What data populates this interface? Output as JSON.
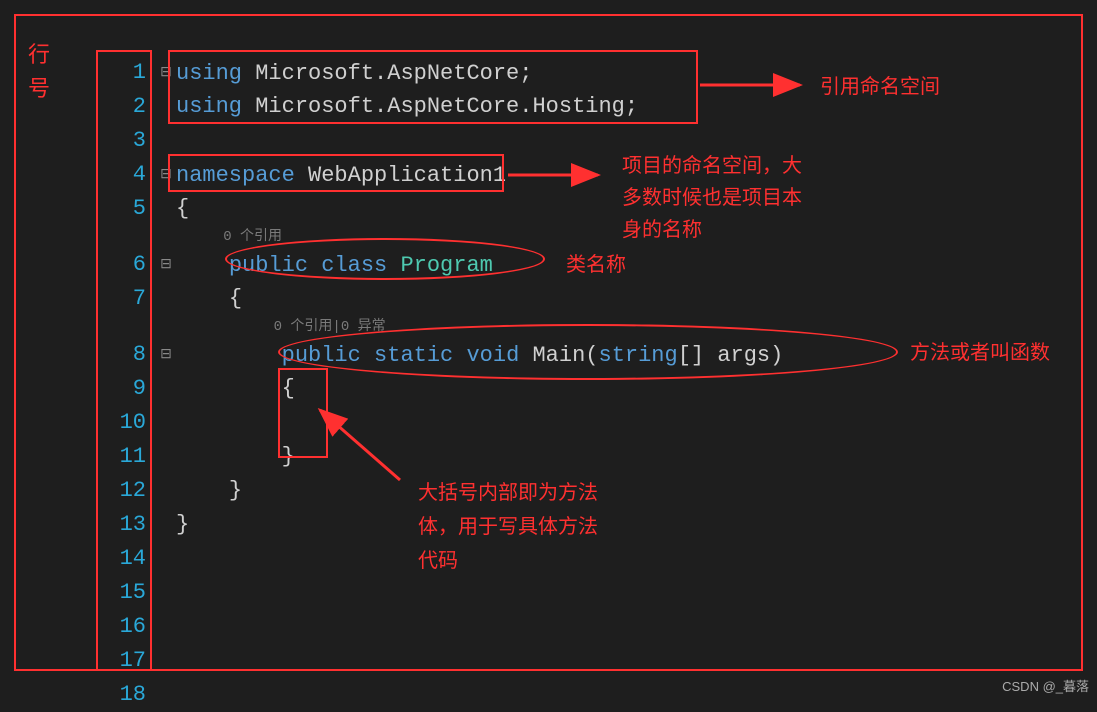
{
  "labels": {
    "row_label": "行\n号",
    "watermark": "CSDN @_暮落"
  },
  "line_numbers": [
    "1",
    "2",
    "3",
    "4",
    "5",
    "6",
    "7",
    "8",
    "9",
    "10",
    "11",
    "12",
    "13",
    "14",
    "15",
    "16",
    "17",
    "18"
  ],
  "fold_icons": {
    "minus": "⊟"
  },
  "code": {
    "line1": {
      "kw": "using",
      "rest": " Microsoft.AspNetCore;"
    },
    "line2": {
      "kw": "using",
      "rest": " Microsoft.AspNetCore.Hosting;"
    },
    "line4": {
      "kw": "namespace",
      "rest": " WebApplication1"
    },
    "line5": "{",
    "codelens1": "0 个引用",
    "line6": {
      "kw1": "public",
      "kw2": "class",
      "type": "Program"
    },
    "line7": "{",
    "codelens2": "0 个引用|0 异常",
    "line8": {
      "kw1": "public",
      "kw2": "static",
      "kw3": "void",
      "name": "Main",
      "paren_open": "(",
      "ptype": "string",
      "brackets": "[] ",
      "pname": "args",
      "paren_close": ")"
    },
    "line9": "{",
    "line11": "}",
    "line12": "}",
    "line13": "}"
  },
  "annotations": {
    "using_label": "引用命名空间",
    "namespace_label_l1": "项目的命名空间，大",
    "namespace_label_l2": "多数时候也是项目本",
    "namespace_label_l3": "身的名称",
    "class_label": "类名称",
    "method_label": "方法或者叫函数",
    "body_label_l1": "大括号内部即为方法",
    "body_label_l2": "体，用于写具体方法",
    "body_label_l3": "代码"
  }
}
